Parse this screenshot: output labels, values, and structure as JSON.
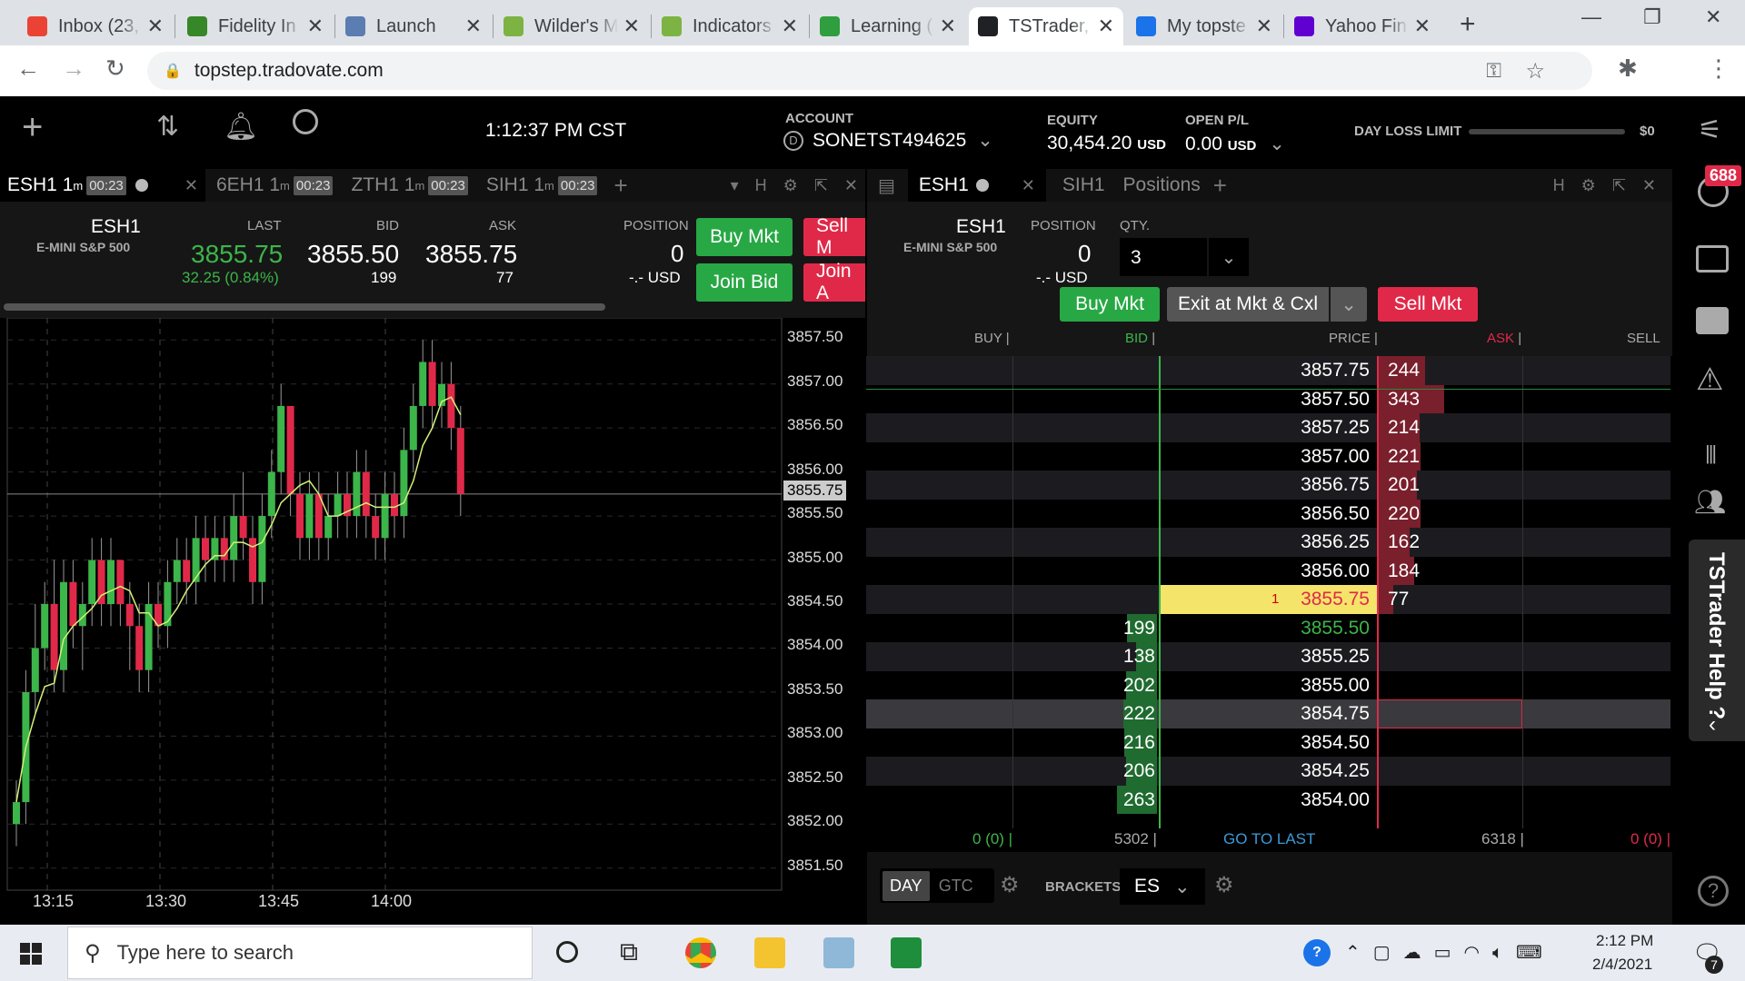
{
  "browser": {
    "tabs": [
      {
        "title": "Inbox (23,",
        "icon": "gmail-icon",
        "color": "#ea4335"
      },
      {
        "title": "Fidelity In",
        "icon": "fidelity-icon",
        "color": "#368727"
      },
      {
        "title": "Launch",
        "icon": "launch-icon",
        "color": "#5b7db1"
      },
      {
        "title": "Wilder's M",
        "icon": "flask-icon",
        "color": "#7cb342"
      },
      {
        "title": "Indicators",
        "icon": "flask-icon",
        "color": "#7cb342"
      },
      {
        "title": "Learning (",
        "icon": "learning-icon",
        "color": "#2e9e3e"
      },
      {
        "title": "TSTrader,",
        "icon": "tstrader-icon",
        "color": "#202124"
      },
      {
        "title": "My topste",
        "icon": "topstep-icon",
        "color": "#1a73e8"
      },
      {
        "title": "Yahoo Fin",
        "icon": "yahoo-icon",
        "color": "#6001d2"
      }
    ],
    "url": "topstep.tradovate.com"
  },
  "header": {
    "time": "1:12:37 PM CST",
    "account_label": "ACCOUNT",
    "account": "SONETST494625",
    "equity_label": "EQUITY",
    "equity": "30,454.20",
    "equity_unit": "USD",
    "openpl_label": "OPEN P/L",
    "openpl": "0.00",
    "openpl_unit": "USD",
    "dll_label": "DAY LOSS LIMIT",
    "dll_value": "$0"
  },
  "left_panel": {
    "tabs": [
      {
        "label": "ESH1 1",
        "sup": "m",
        "badge": "00:23"
      },
      {
        "label": "6EH1 1",
        "sup": "m",
        "badge": "00:23"
      },
      {
        "label": "ZTH1 1",
        "sup": "m",
        "badge": "00:23"
      },
      {
        "label": "SIH1 1",
        "sup": "m",
        "badge": "00:23"
      }
    ],
    "symbol": "ESH1",
    "desc": "E-MINI S&P 500",
    "last_label": "LAST",
    "last": "3855.75",
    "change": "32.25 (0.84%)",
    "bid_label": "BID",
    "bid": "3855.50",
    "bid_size": "199",
    "ask_label": "ASK",
    "ask": "3855.75",
    "ask_size": "77",
    "position_label": "POSITION",
    "position": "0",
    "position_usd": "-.- USD",
    "buy_mkt": "Buy Mkt",
    "sell_mkt": "Sell M",
    "join_bid": "Join Bid",
    "join_ask": "Join A"
  },
  "chart_data": {
    "type": "candlestick",
    "price_labels": [
      "3857.50",
      "3857.00",
      "3856.50",
      "3856.00",
      "3855.50",
      "3855.00",
      "3854.50",
      "3854.00",
      "3853.50",
      "3853.00",
      "3852.50",
      "3852.00",
      "3851.50"
    ],
    "current_price": "3855.75",
    "time_labels": [
      "13:15",
      "13:30",
      "13:45",
      "14:00"
    ],
    "ylim": [
      3851.25,
      3857.75
    ],
    "candles": [
      [
        3852.0,
        3852.25,
        3851.75,
        3852.5
      ],
      [
        3852.25,
        3853.5,
        3852.0,
        3853.75
      ],
      [
        3853.5,
        3854.0,
        3853.25,
        3854.5
      ],
      [
        3854.0,
        3854.5,
        3853.75,
        3854.75
      ],
      [
        3854.5,
        3853.75,
        3853.5,
        3855.0
      ],
      [
        3853.75,
        3854.75,
        3853.5,
        3855.0
      ],
      [
        3854.75,
        3854.25,
        3854.0,
        3855.0
      ],
      [
        3854.25,
        3854.5,
        3853.75,
        3854.75
      ],
      [
        3854.5,
        3855.0,
        3854.25,
        3855.25
      ],
      [
        3855.0,
        3854.5,
        3854.25,
        3855.25
      ],
      [
        3854.5,
        3855.0,
        3854.25,
        3855.25
      ],
      [
        3855.0,
        3854.5,
        3854.25,
        3855.0
      ],
      [
        3854.5,
        3854.25,
        3853.75,
        3854.75
      ],
      [
        3854.25,
        3853.75,
        3853.5,
        3854.5
      ],
      [
        3853.75,
        3854.5,
        3853.5,
        3854.75
      ],
      [
        3854.5,
        3854.25,
        3854.0,
        3854.75
      ],
      [
        3854.25,
        3854.75,
        3854.0,
        3855.0
      ],
      [
        3854.75,
        3855.0,
        3854.5,
        3855.25
      ],
      [
        3855.0,
        3854.75,
        3854.5,
        3855.25
      ],
      [
        3854.75,
        3855.25,
        3854.5,
        3855.5
      ],
      [
        3855.25,
        3855.0,
        3854.75,
        3855.5
      ],
      [
        3855.0,
        3855.25,
        3854.75,
        3855.5
      ],
      [
        3855.25,
        3855.0,
        3854.75,
        3855.5
      ],
      [
        3855.0,
        3855.5,
        3854.75,
        3855.75
      ],
      [
        3855.5,
        3855.25,
        3855.0,
        3856.0
      ],
      [
        3855.25,
        3854.75,
        3854.5,
        3855.5
      ],
      [
        3854.75,
        3855.5,
        3854.5,
        3855.75
      ],
      [
        3855.5,
        3856.0,
        3855.25,
        3856.25
      ],
      [
        3856.0,
        3856.75,
        3855.75,
        3857.0
      ],
      [
        3856.75,
        3855.75,
        3855.5,
        3856.75
      ],
      [
        3855.75,
        3855.25,
        3855.0,
        3856.0
      ],
      [
        3855.25,
        3855.75,
        3855.0,
        3856.0
      ],
      [
        3855.75,
        3855.25,
        3855.0,
        3856.0
      ],
      [
        3855.25,
        3855.5,
        3855.0,
        3855.75
      ],
      [
        3855.5,
        3855.75,
        3855.25,
        3856.0
      ],
      [
        3855.75,
        3855.5,
        3855.25,
        3856.0
      ],
      [
        3855.5,
        3856.0,
        3855.25,
        3856.25
      ],
      [
        3856.0,
        3855.5,
        3855.25,
        3856.25
      ],
      [
        3855.5,
        3855.25,
        3855.0,
        3855.75
      ],
      [
        3855.25,
        3855.75,
        3855.0,
        3856.0
      ],
      [
        3855.75,
        3855.5,
        3855.25,
        3856.0
      ],
      [
        3855.5,
        3856.25,
        3855.25,
        3856.5
      ],
      [
        3856.25,
        3856.75,
        3856.0,
        3857.0
      ],
      [
        3856.75,
        3857.25,
        3856.5,
        3857.5
      ],
      [
        3857.25,
        3856.75,
        3856.5,
        3857.5
      ],
      [
        3856.75,
        3857.0,
        3856.5,
        3857.25
      ],
      [
        3857.0,
        3856.5,
        3856.25,
        3857.25
      ],
      [
        3856.5,
        3855.75,
        3855.5,
        3856.75
      ]
    ]
  },
  "dom_panel": {
    "tabs": [
      "ESH1",
      "SIH1",
      "Positions"
    ],
    "symbol": "ESH1",
    "desc": "E-MINI S&P 500",
    "position_label": "POSITION",
    "position": "0",
    "position_usd": "-.- USD",
    "qty_label": "QTY.",
    "qty": "3",
    "buy_mkt": "Buy Mkt",
    "exit": "Exit at Mkt & Cxl",
    "sell_mkt": "Sell Mkt",
    "col_buy": "BUY",
    "col_bid": "BID",
    "col_price": "PRICE",
    "col_ask": "ASK",
    "col_sell": "SELL",
    "rows": [
      {
        "price": "3857.75",
        "bid": "",
        "ask": "244",
        "ask_pct": 0.71
      },
      {
        "price": "3857.50",
        "bid": "",
        "ask": "343",
        "ask_pct": 1.0
      },
      {
        "price": "3857.25",
        "bid": "",
        "ask": "214",
        "ask_pct": 0.62
      },
      {
        "price": "3857.00",
        "bid": "",
        "ask": "221",
        "ask_pct": 0.64
      },
      {
        "price": "3856.75",
        "bid": "",
        "ask": "201",
        "ask_pct": 0.59
      },
      {
        "price": "3856.50",
        "bid": "",
        "ask": "220",
        "ask_pct": 0.64
      },
      {
        "price": "3856.25",
        "bid": "",
        "ask": "162",
        "ask_pct": 0.47
      },
      {
        "price": "3856.00",
        "bid": "",
        "ask": "184",
        "ask_pct": 0.54
      },
      {
        "price": "3855.75",
        "bid": "",
        "ask": "77",
        "ask_pct": 0.22,
        "last": true,
        "trade_count": "1"
      },
      {
        "price": "3855.50",
        "bid": "199",
        "bid_pct": 0.76,
        "ask": ""
      },
      {
        "price": "3855.25",
        "bid": "138",
        "bid_pct": 0.52,
        "ask": ""
      },
      {
        "price": "3855.00",
        "bid": "202",
        "bid_pct": 0.77,
        "ask": ""
      },
      {
        "price": "3854.75",
        "bid": "222",
        "bid_pct": 0.84,
        "ask": "",
        "hover": true
      },
      {
        "price": "3854.50",
        "bid": "216",
        "bid_pct": 0.82,
        "ask": ""
      },
      {
        "price": "3854.25",
        "bid": "206",
        "bid_pct": 0.78,
        "ask": ""
      },
      {
        "price": "3854.00",
        "bid": "263",
        "bid_pct": 1.0,
        "ask": ""
      }
    ],
    "footer": {
      "buy": "0 (0) |",
      "bid_total": "5302 |",
      "goto": "GO TO LAST",
      "ask_total": "6318 |",
      "sell": "0 (0) |"
    },
    "day": "DAY",
    "gtc": "GTC",
    "brackets_label": "BRACKETS",
    "brackets": "ES"
  },
  "sidebar": {
    "badge": "688",
    "help": "TSTrader Help ?"
  },
  "taskbar": {
    "search_placeholder": "Type here to search",
    "time": "2:12 PM",
    "date": "2/4/2021",
    "notif_count": "7"
  }
}
